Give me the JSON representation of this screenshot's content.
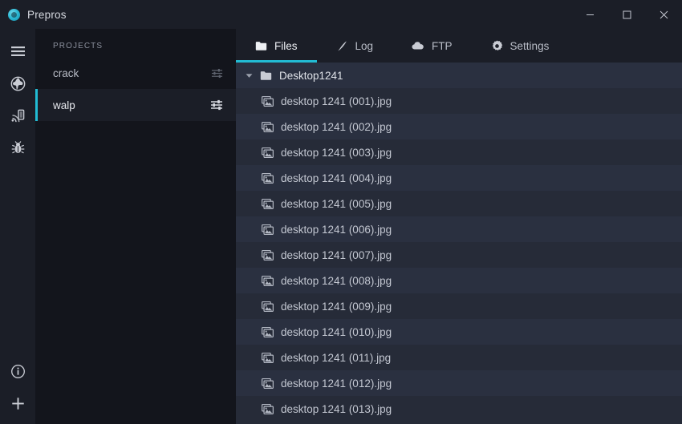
{
  "window": {
    "app_title": "Prepros",
    "logo_icon": "prepros-logo-icon",
    "controls": {
      "minimize": "minimize-icon",
      "maximize": "maximize-icon",
      "close": "close-icon"
    }
  },
  "colors": {
    "accent": "#22bcd4",
    "titlebar_bg": "#1b1e27",
    "projects_bg": "#13151c",
    "main_bg": "#262b38",
    "row_alt_bg": "#2a3040",
    "text_primary": "#dfe2e8",
    "text_secondary": "#8c919e"
  },
  "rail": {
    "items": [
      {
        "icon": "hamburger-menu-icon",
        "name": "menu"
      },
      {
        "icon": "globe-icon",
        "name": "browser-preview"
      },
      {
        "icon": "mobile-device-icon",
        "name": "remote-preview"
      },
      {
        "icon": "bug-icon",
        "name": "debugger"
      }
    ],
    "bottom_items": [
      {
        "icon": "info-circle-icon",
        "name": "info"
      },
      {
        "icon": "plus-icon",
        "name": "add-project"
      }
    ]
  },
  "projects": {
    "header": "PROJECTS",
    "items": [
      {
        "label": "crack",
        "selected": false,
        "settings_icon": "sliders-icon"
      },
      {
        "label": "walp",
        "selected": true,
        "settings_icon": "sliders-icon"
      }
    ]
  },
  "tabs": [
    {
      "label": "Files",
      "icon": "folder-icon",
      "active": true
    },
    {
      "label": "Log",
      "icon": "pen-icon",
      "active": false
    },
    {
      "label": "FTP",
      "icon": "cloud-icon",
      "active": false
    },
    {
      "label": "Settings",
      "icon": "gear-icon",
      "active": false
    }
  ],
  "filelist": {
    "folder": {
      "label": "Desktop1241",
      "icon": "folder-icon",
      "caret": "chevron-down-icon",
      "expanded": true
    },
    "files": [
      {
        "label": "desktop 1241 (001).jpg",
        "icon": "image-file-icon"
      },
      {
        "label": "desktop 1241 (002).jpg",
        "icon": "image-file-icon"
      },
      {
        "label": "desktop 1241 (003).jpg",
        "icon": "image-file-icon"
      },
      {
        "label": "desktop 1241 (004).jpg",
        "icon": "image-file-icon"
      },
      {
        "label": "desktop 1241 (005).jpg",
        "icon": "image-file-icon"
      },
      {
        "label": "desktop 1241 (006).jpg",
        "icon": "image-file-icon"
      },
      {
        "label": "desktop 1241 (007).jpg",
        "icon": "image-file-icon"
      },
      {
        "label": "desktop 1241 (008).jpg",
        "icon": "image-file-icon"
      },
      {
        "label": "desktop 1241 (009).jpg",
        "icon": "image-file-icon"
      },
      {
        "label": "desktop 1241 (010).jpg",
        "icon": "image-file-icon"
      },
      {
        "label": "desktop 1241 (011).jpg",
        "icon": "image-file-icon"
      },
      {
        "label": "desktop 1241 (012).jpg",
        "icon": "image-file-icon"
      },
      {
        "label": "desktop 1241 (013).jpg",
        "icon": "image-file-icon"
      }
    ]
  }
}
